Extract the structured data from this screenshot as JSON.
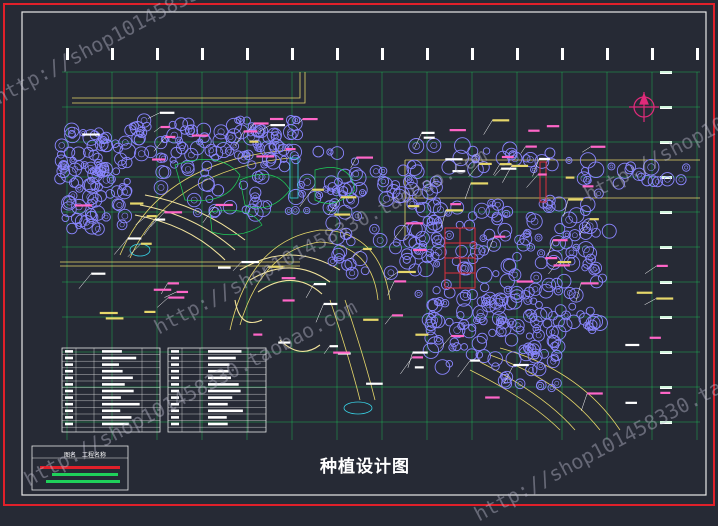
{
  "drawing": {
    "title": "种植设计图",
    "watermark_text": "http://shop101458330.taobao.com",
    "stamp_left": "图名",
    "stamp_right": "工程名称",
    "colors": {
      "background": "#262a35",
      "frame_red": "#e0202a",
      "frame_white": "#e8e8e8",
      "grid": "#1fd05a",
      "roads": "#e6d76a",
      "plants": "#8a86ff",
      "paving": "#f2e39c",
      "labels": "#ff66c8",
      "cyan": "#38d4e8",
      "red_block": "#d9303a",
      "table_lines": "#e6e6e6"
    },
    "icons": [
      "north-arrow-icon",
      "tree-symbol-icon"
    ]
  }
}
